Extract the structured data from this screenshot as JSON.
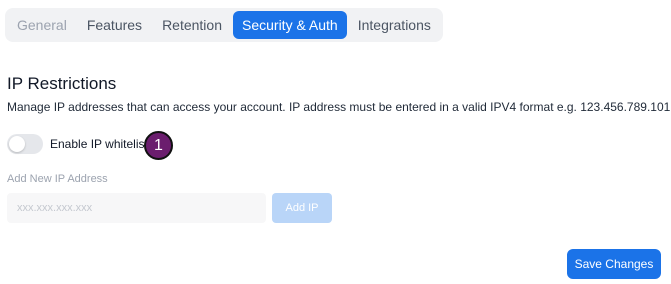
{
  "tabs": [
    {
      "label": "General",
      "state": "dimmed"
    },
    {
      "label": "Features",
      "state": "normal"
    },
    {
      "label": "Retention",
      "state": "normal"
    },
    {
      "label": "Security & Auth",
      "state": "active"
    },
    {
      "label": "Integrations",
      "state": "normal"
    }
  ],
  "ip_restrictions": {
    "title": "IP Restrictions",
    "description": "Manage IP addresses that can access your account. IP address must be entered in a valid IPV4 format e.g. 123.456.789.101",
    "toggle_label": "Enable IP whitelist",
    "toggle_on": false,
    "step_badge": "1",
    "add_label": "Add New IP Address",
    "input_value": "",
    "input_placeholder": "xxx.xxx.xxx.xxx",
    "add_button_label": "Add IP"
  },
  "footer": {
    "save_label": "Save Changes"
  },
  "colors": {
    "accent": "#1b73e8",
    "accent_disabled": "#b9d5f8",
    "badge": "#6b1d6e"
  }
}
